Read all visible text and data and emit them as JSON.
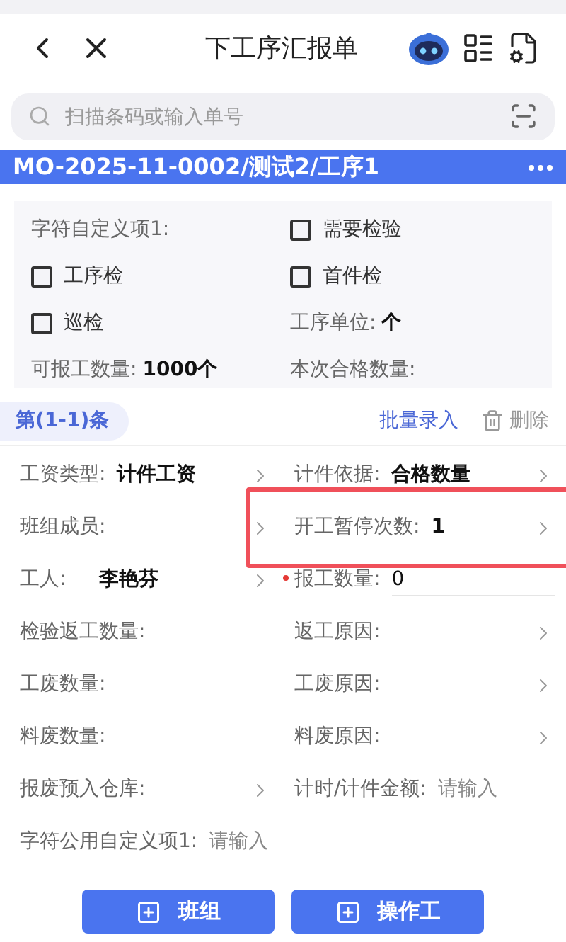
{
  "header": {
    "title": "下工序汇报单"
  },
  "search": {
    "placeholder": "扫描条码或输入单号"
  },
  "order_bar": {
    "title": "MO-2025-11-0002/测试2/工序1"
  },
  "info_card": [
    {
      "kind": "text",
      "label": "字符自定义项1:"
    },
    {
      "kind": "checkbox",
      "label": "需要检验",
      "checked": false
    },
    {
      "kind": "checkbox",
      "label": "工序检",
      "checked": false
    },
    {
      "kind": "checkbox",
      "label": "首件检",
      "checked": false
    },
    {
      "kind": "checkbox",
      "label": "巡检",
      "checked": false
    },
    {
      "kind": "text",
      "label": "工序单位:",
      "value": "个"
    },
    {
      "kind": "text",
      "label": "可报工数量:",
      "value": "1000个"
    },
    {
      "kind": "text",
      "label": "本次合格数量:"
    }
  ],
  "record_bar": {
    "counter": "第(1-1)条",
    "batch_entry": "批量录入",
    "delete": "删除"
  },
  "fields": [
    {
      "kind": "select",
      "label": "工资类型:",
      "value": "计件工资",
      "required": false,
      "highlighted": false
    },
    {
      "kind": "select",
      "label": "计件依据:",
      "value": "合格数量",
      "required": false,
      "highlighted": false
    },
    {
      "kind": "select",
      "label": "班组成员:",
      "required": false,
      "highlighted": false
    },
    {
      "kind": "select",
      "label": "开工暂停次数:",
      "value": "1",
      "required": false,
      "highlighted": true
    },
    {
      "kind": "select",
      "label": "工人:",
      "value": "李艳芬",
      "required": false,
      "highlighted": false
    },
    {
      "kind": "input",
      "label": "报工数量:",
      "value": "0",
      "required": true,
      "highlighted": false
    },
    {
      "kind": "text",
      "label": "检验返工数量:",
      "required": false,
      "highlighted": false
    },
    {
      "kind": "select",
      "label": "返工原因:",
      "required": false,
      "highlighted": false
    },
    {
      "kind": "text",
      "label": "工废数量:",
      "required": false,
      "highlighted": false
    },
    {
      "kind": "select",
      "label": "工废原因:",
      "required": false,
      "highlighted": false
    },
    {
      "kind": "text",
      "label": "料废数量:",
      "required": false,
      "highlighted": false
    },
    {
      "kind": "select",
      "label": "料废原因:",
      "required": false,
      "highlighted": false
    },
    {
      "kind": "select",
      "label": "报废预入仓库:",
      "required": false,
      "highlighted": false
    },
    {
      "kind": "input",
      "label": "计时/计件金额:",
      "placeholder": "请输入",
      "required": false,
      "highlighted": false
    },
    {
      "kind": "input",
      "label": "字符公用自定义项1:",
      "placeholder": "请输入",
      "required": false,
      "highlighted": false
    }
  ],
  "buttons": [
    {
      "label": "班组"
    },
    {
      "label": "操作工"
    }
  ]
}
